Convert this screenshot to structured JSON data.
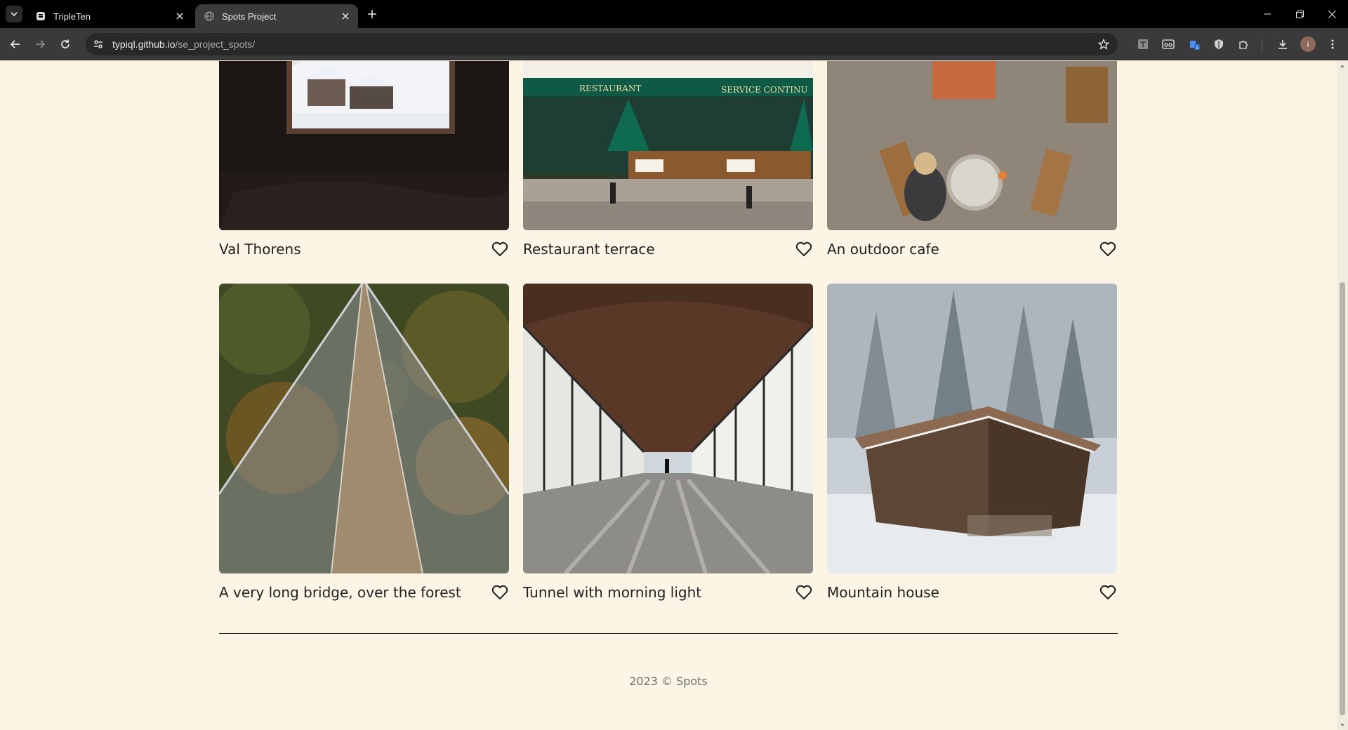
{
  "browser": {
    "tabs": [
      {
        "title": "TripleTen",
        "active": false
      },
      {
        "title": "Spots Project",
        "active": true
      }
    ],
    "url_host": "typiql.github.io",
    "url_path": "/se_project_spots/",
    "profile_initial": "i"
  },
  "cards": [
    {
      "title": "Val Thorens",
      "image": "snowy-resort-through-window"
    },
    {
      "title": "Restaurant terrace",
      "image": "green-restaurant-facade"
    },
    {
      "title": "An outdoor cafe",
      "image": "cafe-tables-from-above"
    },
    {
      "title": "A very long bridge, over the forest",
      "image": "suspension-bridge-forest"
    },
    {
      "title": "Tunnel with morning light",
      "image": "glass-corridor-tunnel"
    },
    {
      "title": "Mountain house",
      "image": "wooden-cabin-snow"
    }
  ],
  "restaurant_signs": {
    "left": "RESTAURANT",
    "right": "SERVICE CONTINU"
  },
  "footer": {
    "text": "2023 © Spots"
  },
  "colors": {
    "page_bg": "#fcf5e5",
    "text": "#212121",
    "footer_text": "#6e6e6e"
  }
}
